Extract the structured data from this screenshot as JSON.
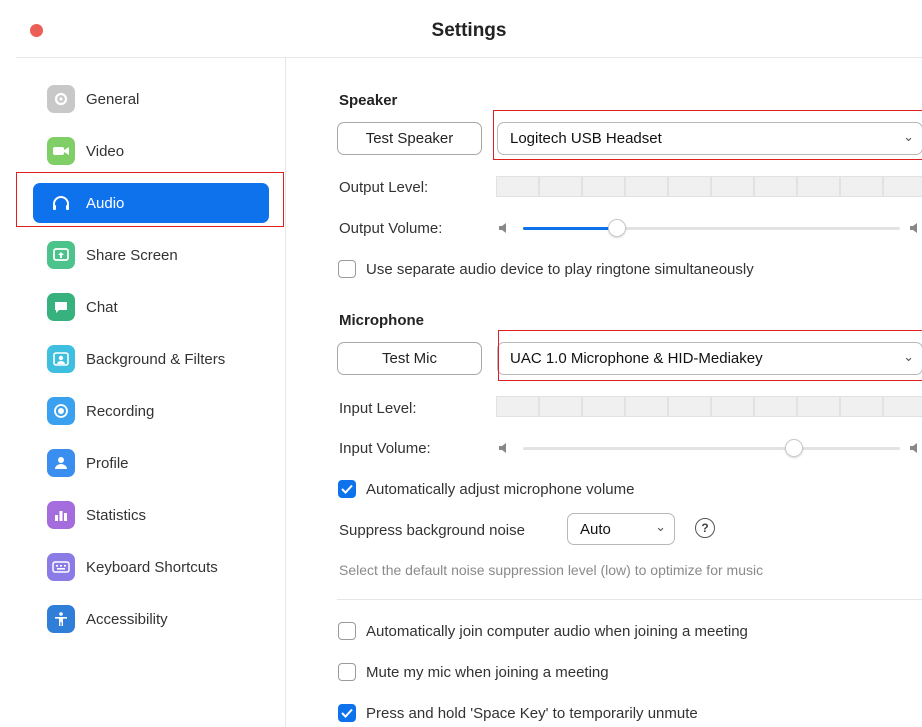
{
  "window": {
    "title": "Settings"
  },
  "sidebar": {
    "items": [
      {
        "label": "General",
        "icon": "gear-icon",
        "color": "#c8c8c8"
      },
      {
        "label": "Video",
        "icon": "video-camera-icon",
        "color": "#7fcf66"
      },
      {
        "label": "Audio",
        "icon": "headphones-icon",
        "color": "#0e72ed",
        "active": true
      },
      {
        "label": "Share Screen",
        "icon": "share-screen-icon",
        "color": "#4cc38a"
      },
      {
        "label": "Chat",
        "icon": "chat-bubble-icon",
        "color": "#37b27e"
      },
      {
        "label": "Background & Filters",
        "icon": "background-person-icon",
        "color": "#3fbfe0"
      },
      {
        "label": "Recording",
        "icon": "record-icon",
        "color": "#3aa0f0"
      },
      {
        "label": "Profile",
        "icon": "profile-icon",
        "color": "#3a8ef0"
      },
      {
        "label": "Statistics",
        "icon": "bar-chart-icon",
        "color": "#a46cdc"
      },
      {
        "label": "Keyboard Shortcuts",
        "icon": "keyboard-icon",
        "color": "#8b7be6"
      },
      {
        "label": "Accessibility",
        "icon": "accessibility-icon",
        "color": "#2f7fd8"
      }
    ]
  },
  "speaker": {
    "title": "Speaker",
    "test_button": "Test Speaker",
    "device": "Logitech USB Headset",
    "output_level_label": "Output Level:",
    "output_volume_label": "Output Volume:",
    "output_volume_fraction": 0.25,
    "separate_device_label": "Use separate audio device to play ringtone simultaneously",
    "separate_device_checked": false
  },
  "microphone": {
    "title": "Microphone",
    "test_button": "Test Mic",
    "device": "UAC 1.0 Microphone & HID-Mediakey",
    "input_level_label": "Input Level:",
    "input_volume_label": "Input Volume:",
    "input_volume_fraction": 0.72,
    "auto_adjust_label": "Automatically adjust microphone volume",
    "auto_adjust_checked": true,
    "suppress_label": "Suppress background noise",
    "suppress_value": "Auto",
    "suppress_hint": "Select the default noise suppression level (low) to optimize for music"
  },
  "options": {
    "auto_join_label": "Automatically join computer audio when joining a meeting",
    "auto_join_checked": false,
    "mute_label": "Mute my mic when joining a meeting",
    "mute_checked": false,
    "space_key_label": "Press and hold 'Space Key' to temporarily unmute",
    "space_key_checked": true
  },
  "colors": {
    "accent": "#0e72ed",
    "highlight": "#e02020",
    "close": "#ec5f57"
  }
}
